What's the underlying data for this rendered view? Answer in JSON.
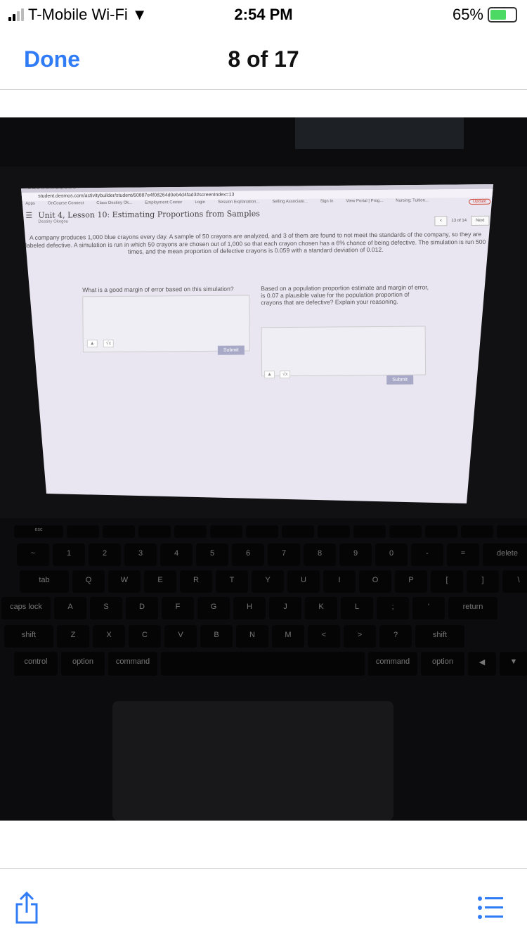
{
  "status": {
    "carrier": "T-Mobile Wi-Fi",
    "time": "2:54 PM",
    "battery": "65%",
    "battery_level": 65
  },
  "nav": {
    "done": "Done",
    "title": "8 of 17"
  },
  "photo": {
    "tabs": "B  ⊞  D  M  G  W  G  M  S  M  D  +",
    "url": "student.desmos.com/activitybuilder/student/60887e4f08264d0eb4d4fad3#screenIndex=13",
    "bookmarks": [
      "Apps",
      "OnCourse Connect",
      "Class Destiny Ok...",
      "Employment Center",
      "Login",
      "Session Explanation...",
      "Selling Associate...",
      "Sign In",
      "View Portal | Prog...",
      "Nursing: Tuition..."
    ],
    "update": "Update",
    "unit_title": "Unit 4, Lesson 10: Estimating Proportions from Samples",
    "student": "Destiny Okegou",
    "pager": "13 of 14",
    "next": "Next",
    "question": "A company produces 1,000 blue crayons every day. A sample of 50 crayons are analyzed, and 3 of them are found to not meet the standards of the company, so they are labeled defective. A simulation is run in which 50 crayons are chosen out of 1,000 so that each crayon chosen has a 6% chance of being defective. The simulation is run 500 times, and the mean proportion of defective crayons is 0.059 with a standard deviation of 0.012.",
    "prompt1": "What is a good margin of error based on this simulation?",
    "prompt2": "Based on a population proportion estimate and margin of error, is 0.07 a plausible value for the population proportion of crayons that are defective? Explain your reasoning.",
    "submit": "Submit",
    "sqrt": "√x",
    "keys": [
      [
        "esc",
        "",
        "",
        "",
        "",
        "",
        "",
        "",
        "",
        "",
        "",
        "",
        "",
        ""
      ],
      [
        "~",
        "1",
        "2",
        "3",
        "4",
        "5",
        "6",
        "7",
        "8",
        "9",
        "0",
        "-",
        "=",
        "delete"
      ],
      [
        "tab",
        "Q",
        "W",
        "E",
        "R",
        "T",
        "Y",
        "U",
        "I",
        "O",
        "P",
        "[",
        "]",
        "\\"
      ],
      [
        "caps lock",
        "A",
        "S",
        "D",
        "F",
        "G",
        "H",
        "J",
        "K",
        "L",
        ";",
        "'",
        "return"
      ],
      [
        "shift",
        "Z",
        "X",
        "C",
        "V",
        "B",
        "N",
        "M",
        "<",
        ">",
        "?",
        "shift"
      ],
      [
        "control",
        "option",
        "command",
        "",
        "command",
        "option",
        "◀",
        "▼",
        "▶"
      ]
    ]
  },
  "toolbar": {
    "share": "share-icon",
    "list": "list-icon"
  }
}
